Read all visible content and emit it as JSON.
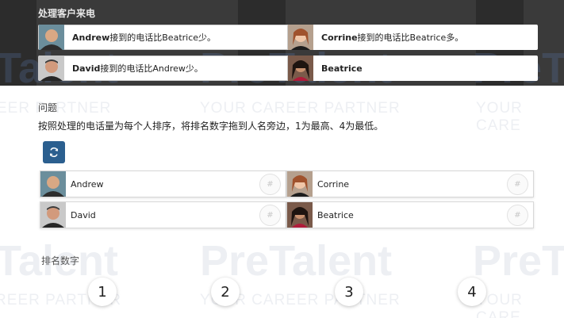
{
  "scenario": {
    "title": "处理客户来电",
    "clues": [
      {
        "name": "Andrew",
        "text": "接到的电话比Beatrice少。",
        "avatar": "man-bald-smiling"
      },
      {
        "name": "Corrine",
        "text": "接到的电话比Beatrice多。",
        "avatar": "woman-red-hair"
      },
      {
        "name": "David",
        "text": "接到的电话比Andrew少。",
        "avatar": "man-short-hair"
      },
      {
        "name": "Beatrice",
        "text": "",
        "avatar": "woman-dark-hair"
      }
    ]
  },
  "question": {
    "label": "问题",
    "text": "按照处理的电话量为每个人排序，将排名数字拖到人名旁边，1为最高、4为最低。"
  },
  "reset_icon": "refresh-icon",
  "people": [
    {
      "name": "Andrew",
      "slot": "#"
    },
    {
      "name": "Corrine",
      "slot": "#"
    },
    {
      "name": "David",
      "slot": "#"
    },
    {
      "name": "Beatrice",
      "slot": "#"
    }
  ],
  "ranks": {
    "label": "排名数字",
    "items": [
      "1",
      "2",
      "3",
      "4"
    ]
  },
  "watermark": {
    "brand": "PreTalent",
    "tagline": "YOUR CAREER PARTNER",
    "tagline_cut": "REER PARTNER",
    "tagline_left": "EER PARTNER",
    "tagline_right": "YOUR CARE",
    "brand_left": "Talent",
    "brand_right": "PreT"
  },
  "colors": {
    "accent": "#2b5f8f",
    "scenario_bg": "#3a3a3a"
  }
}
